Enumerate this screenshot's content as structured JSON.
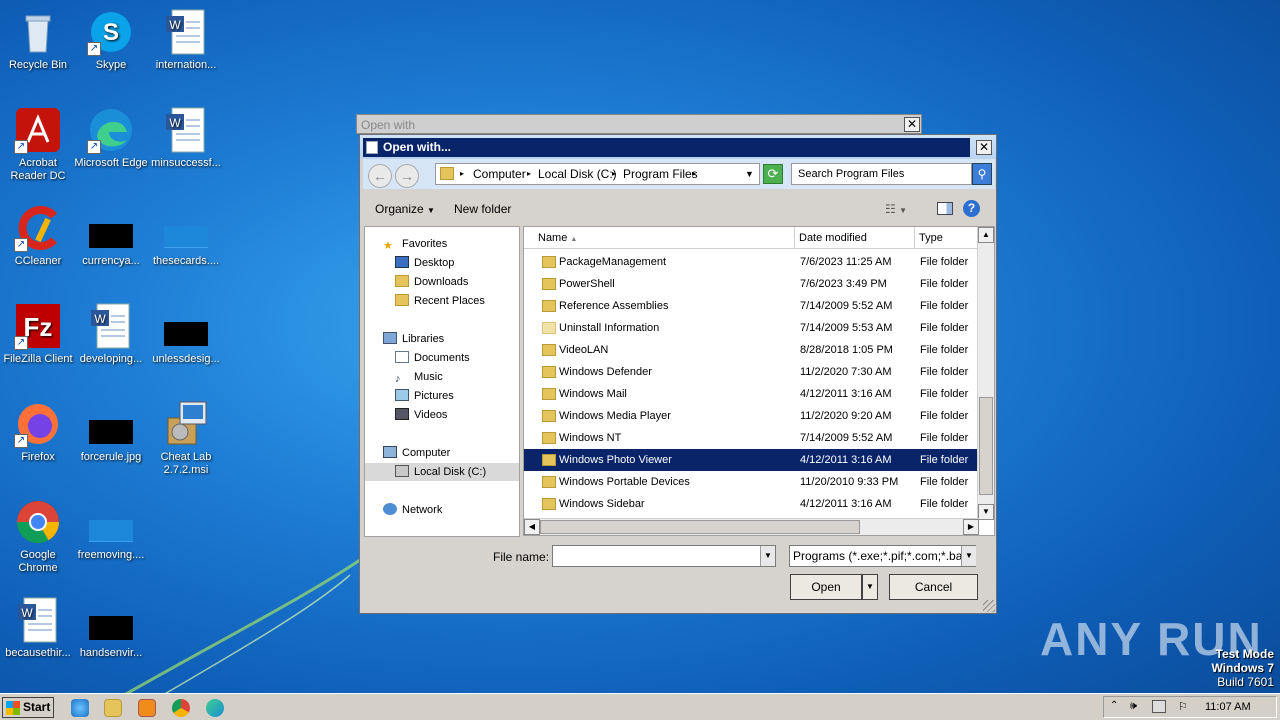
{
  "desktop": {
    "icons": [
      {
        "label": "Recycle Bin"
      },
      {
        "label": "Skype"
      },
      {
        "label": "internation..."
      },
      {
        "label": "Acrobat Reader DC"
      },
      {
        "label": "Microsoft Edge"
      },
      {
        "label": "minsuccessf..."
      },
      {
        "label": "CCleaner"
      },
      {
        "label": "currencya..."
      },
      {
        "label": "thesecards...."
      },
      {
        "label": "FileZilla Client"
      },
      {
        "label": "developing..."
      },
      {
        "label": "unlessdesig..."
      },
      {
        "label": "Firefox"
      },
      {
        "label": "forcerule.jpg"
      },
      {
        "label": "Cheat Lab 2.7.2.msi"
      },
      {
        "label": "Google Chrome"
      },
      {
        "label": "freemoving...."
      },
      {
        "label": "becausethir..."
      },
      {
        "label": "handsenvir..."
      }
    ]
  },
  "back_dialog": {
    "title": "Open with",
    "close": "✕"
  },
  "dialog": {
    "title": "Open with...",
    "close": "✕",
    "address": {
      "c1": "Computer",
      "c2": "Local Disk (C:)",
      "c3": "Program Files"
    },
    "search_placeholder": "Search Program Files",
    "toolbar": {
      "organize": "Organize",
      "new_folder": "New folder"
    },
    "nav": {
      "favorites": "Favorites",
      "desktop": "Desktop",
      "downloads": "Downloads",
      "recent": "Recent Places",
      "libraries": "Libraries",
      "documents": "Documents",
      "music": "Music",
      "pictures": "Pictures",
      "videos": "Videos",
      "computer": "Computer",
      "local_disk": "Local Disk (C:)",
      "network": "Network"
    },
    "columns": {
      "name": "Name",
      "date": "Date modified",
      "type": "Type"
    },
    "files": [
      {
        "name": "PackageManagement",
        "date": "7/6/2023 11:25 AM",
        "type": "File folder"
      },
      {
        "name": "PowerShell",
        "date": "7/6/2023 3:49 PM",
        "type": "File folder"
      },
      {
        "name": "Reference Assemblies",
        "date": "7/14/2009 5:52 AM",
        "type": "File folder"
      },
      {
        "name": "Uninstall Information",
        "date": "7/14/2009 5:53 AM",
        "type": "File folder"
      },
      {
        "name": "VideoLAN",
        "date": "8/28/2018 1:05 PM",
        "type": "File folder"
      },
      {
        "name": "Windows Defender",
        "date": "11/2/2020 7:30 AM",
        "type": "File folder"
      },
      {
        "name": "Windows Mail",
        "date": "4/12/2011 3:16 AM",
        "type": "File folder"
      },
      {
        "name": "Windows Media Player",
        "date": "11/2/2020 9:20 AM",
        "type": "File folder"
      },
      {
        "name": "Windows NT",
        "date": "7/14/2009 5:52 AM",
        "type": "File folder"
      },
      {
        "name": "Windows Photo Viewer",
        "date": "4/12/2011 3:16 AM",
        "type": "File folder"
      },
      {
        "name": "Windows Portable Devices",
        "date": "11/20/2010 9:33 PM",
        "type": "File folder"
      },
      {
        "name": "Windows Sidebar",
        "date": "4/12/2011 3:16 AM",
        "type": "File folder"
      }
    ],
    "selected_file": "Windows Photo Viewer",
    "file_name_label": "File name:",
    "file_name_value": "",
    "filter": "Programs (*.exe;*.pif;*.com;*.bat;*.cmd)",
    "open_button": "Open",
    "cancel_button": "Cancel"
  },
  "watermark": {
    "text": "ANY RUN",
    "test_mode": "Test Mode",
    "os": "Windows 7",
    "build": "Build 7601"
  },
  "taskbar": {
    "start": "Start",
    "clock": "11:07 AM"
  }
}
